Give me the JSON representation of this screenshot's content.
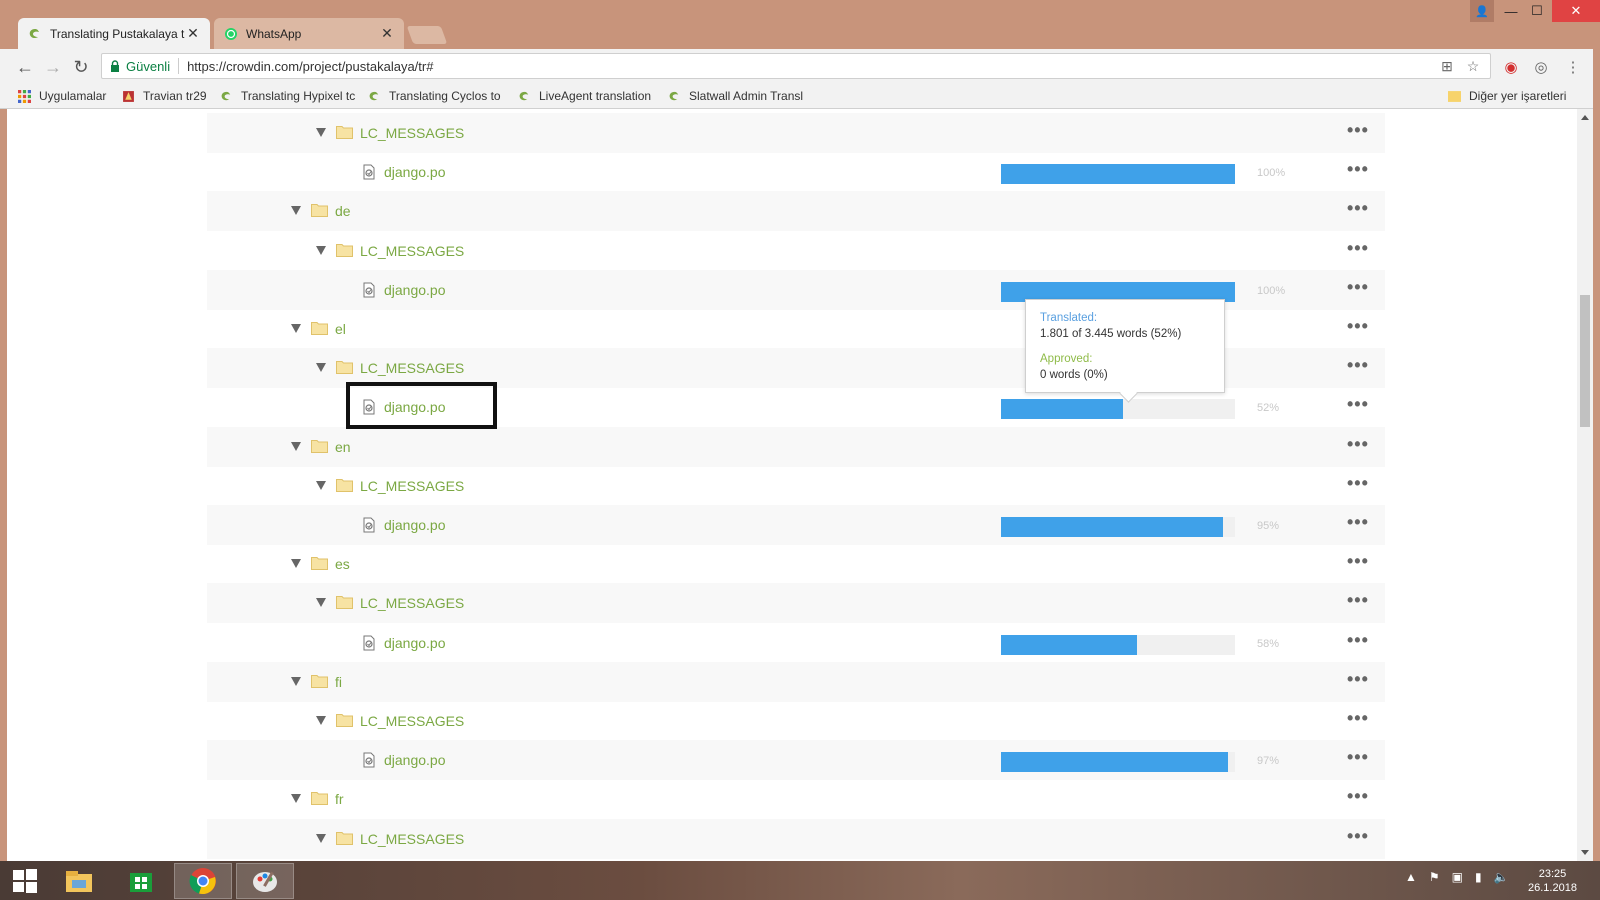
{
  "browser": {
    "tabs": [
      {
        "title": "Translating Pustakalaya t",
        "icon": "crowdin-icon",
        "active": true
      },
      {
        "title": "WhatsApp",
        "icon": "whatsapp-icon",
        "active": false
      }
    ],
    "security_label": "Güvenli",
    "url": "https://crowdin.com/project/pustakalaya/tr#",
    "bookmarks": [
      {
        "label": "Uygulamalar",
        "icon": "apps-grid-icon"
      },
      {
        "label": "Travian tr29",
        "icon": "travian-icon"
      },
      {
        "label": "Translating Hypixel tc",
        "icon": "crowdin-icon"
      },
      {
        "label": "Translating Cyclos to",
        "icon": "crowdin-icon"
      },
      {
        "label": "LiveAgent translation",
        "icon": "crowdin-icon"
      },
      {
        "label": "Slatwall Admin Transl",
        "icon": "crowdin-icon"
      }
    ],
    "other_bookmarks": "Diğer yer işaretleri"
  },
  "file_tree": {
    "rows": [
      {
        "type": "folder",
        "name": "LC_MESSAGES",
        "level": 2,
        "more_label": "•••"
      },
      {
        "type": "file",
        "name": "django.po",
        "progress": 100,
        "percent_label": "100%",
        "more_label": "•••"
      },
      {
        "type": "folder",
        "name": "de",
        "level": 1,
        "more_label": "•••"
      },
      {
        "type": "folder",
        "name": "LC_MESSAGES",
        "level": 2,
        "more_label": "•••"
      },
      {
        "type": "file",
        "name": "django.po",
        "progress": 100,
        "percent_label": "100%",
        "more_label": "•••"
      },
      {
        "type": "folder",
        "name": "el",
        "level": 1,
        "more_label": "•••"
      },
      {
        "type": "folder",
        "name": "LC_MESSAGES",
        "level": 2,
        "more_label": "•••"
      },
      {
        "type": "file",
        "name": "django.po",
        "progress": 52,
        "percent_label": "52%",
        "more_label": "•••"
      },
      {
        "type": "folder",
        "name": "en",
        "level": 1,
        "more_label": "•••"
      },
      {
        "type": "folder",
        "name": "LC_MESSAGES",
        "level": 2,
        "more_label": "•••"
      },
      {
        "type": "file",
        "name": "django.po",
        "progress": 95,
        "percent_label": "95%",
        "more_label": "•••"
      },
      {
        "type": "folder",
        "name": "es",
        "level": 1,
        "more_label": "•••"
      },
      {
        "type": "folder",
        "name": "LC_MESSAGES",
        "level": 2,
        "more_label": "•••"
      },
      {
        "type": "file",
        "name": "django.po",
        "progress": 58,
        "percent_label": "58%",
        "more_label": "•••"
      },
      {
        "type": "folder",
        "name": "fi",
        "level": 1,
        "more_label": "•••"
      },
      {
        "type": "folder",
        "name": "LC_MESSAGES",
        "level": 2,
        "more_label": "•••"
      },
      {
        "type": "file",
        "name": "django.po",
        "progress": 97,
        "percent_label": "97%",
        "more_label": "•••"
      },
      {
        "type": "folder",
        "name": "fr",
        "level": 1,
        "more_label": "•••"
      },
      {
        "type": "folder",
        "name": "LC_MESSAGES",
        "level": 2,
        "more_label": "•••"
      }
    ]
  },
  "tooltip": {
    "translated_label": "Translated:",
    "translated_value": "1.801 of 3.445 words (52%)",
    "approved_label": "Approved:",
    "approved_value": "0 words (0%)"
  },
  "taskbar": {
    "time": "23:25",
    "date": "26.1.2018"
  },
  "colors": {
    "accent_green": "#7ba843",
    "progress_blue": "#3fa1e9",
    "tooltip_translated": "#5aa0e0",
    "tooltip_approved": "#8fbb48"
  }
}
